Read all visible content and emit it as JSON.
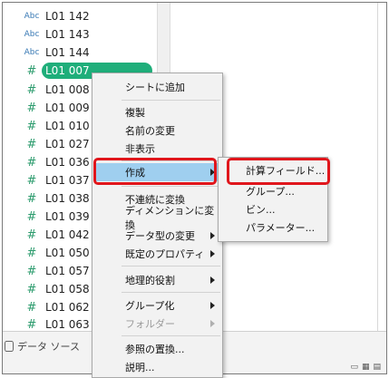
{
  "fields": [
    {
      "type": "Abc",
      "label": "L01 142"
    },
    {
      "type": "Abc",
      "label": "L01 143"
    },
    {
      "type": "Abc",
      "label": "L01 144"
    },
    {
      "type": "#",
      "label": "L01 007",
      "selected": true
    },
    {
      "type": "#",
      "label": "L01 008"
    },
    {
      "type": "#",
      "label": "L01 009"
    },
    {
      "type": "#",
      "label": "L01 010"
    },
    {
      "type": "#",
      "label": "L01 027"
    },
    {
      "type": "#",
      "label": "L01 036"
    },
    {
      "type": "#",
      "label": "L01 037"
    },
    {
      "type": "#",
      "label": "L01 038"
    },
    {
      "type": "#",
      "label": "L01 039"
    },
    {
      "type": "#",
      "label": "L01 042"
    },
    {
      "type": "#",
      "label": "L01 050"
    },
    {
      "type": "#",
      "label": "L01 057"
    },
    {
      "type": "#",
      "label": "L01 058"
    },
    {
      "type": "#",
      "label": "L01 062"
    },
    {
      "type": "#",
      "label": "L01 063"
    }
  ],
  "bottom": {
    "datasource_tab": "データ ソース"
  },
  "menu": {
    "items": [
      {
        "label": "シートに追加"
      },
      {
        "label": "複製"
      },
      {
        "label": "名前の変更"
      },
      {
        "label": "非表示"
      },
      {
        "label": "作成",
        "submenu": true,
        "highlight": true
      },
      {
        "label": "不連続に変換"
      },
      {
        "label": "ディメンションに変換"
      },
      {
        "label": "データ型の変更",
        "submenu": true
      },
      {
        "label": "既定のプロパティ",
        "submenu": true
      },
      {
        "label": "地理的役割",
        "submenu": true
      },
      {
        "label": "グループ化",
        "submenu": true
      },
      {
        "label": "フォルダー",
        "submenu": true,
        "disabled": true
      },
      {
        "label": "参照の置換..."
      },
      {
        "label": "説明..."
      }
    ]
  },
  "submenu": {
    "items": [
      {
        "label": "計算フィールド..."
      },
      {
        "label": "グループ..."
      },
      {
        "label": "ビン..."
      },
      {
        "label": "パラメーター..."
      }
    ]
  },
  "colors": {
    "selected_pill": "#1fae7a",
    "highlight": "#9fcfef",
    "callout_red": "#e0161c"
  }
}
